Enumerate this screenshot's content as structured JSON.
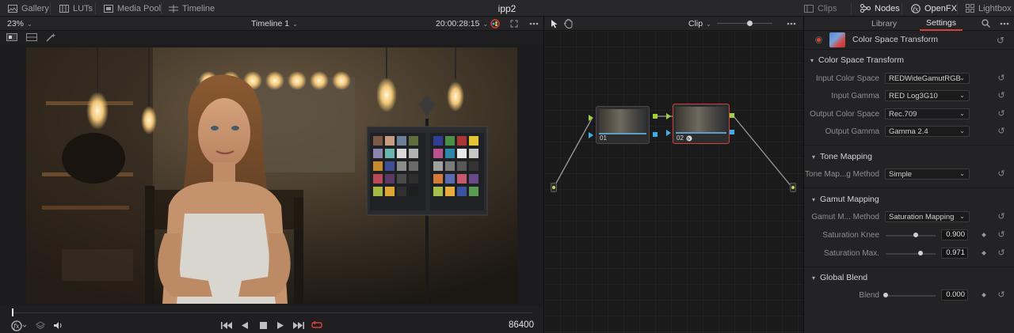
{
  "topbar": {
    "gallery": "Gallery",
    "luts": "LUTs",
    "media_pool": "Media Pool",
    "timeline": "Timeline",
    "project_title": "ipp2",
    "clips": "Clips",
    "nodes": "Nodes",
    "openfx": "OpenFX",
    "lightbox": "Lightbox"
  },
  "viewer": {
    "zoom": "23%",
    "timeline_name": "Timeline 1",
    "timecode": "20:00:28:15",
    "frame_counter": "86400"
  },
  "node_editor": {
    "mode": "Clip",
    "nodes": [
      {
        "label": "01"
      },
      {
        "label": "02"
      }
    ]
  },
  "inspector": {
    "tabs": [
      "Library",
      "Settings"
    ],
    "active_tab": "Settings",
    "fx_name": "Color Space Transform",
    "sections": {
      "cst": {
        "title": "Color Space Transform",
        "input_color_space_label": "Input Color Space",
        "input_color_space": "REDWideGamutRGB",
        "input_gamma_label": "Input Gamma",
        "input_gamma": "RED Log3G10",
        "output_color_space_label": "Output Color Space",
        "output_color_space": "Rec.709",
        "output_gamma_label": "Output Gamma",
        "output_gamma": "Gamma 2.4"
      },
      "tone": {
        "title": "Tone Mapping",
        "method_label": "Tone Map...g Method",
        "method": "Simple"
      },
      "gamut": {
        "title": "Gamut Mapping",
        "method_label": "Gamut M... Method",
        "method": "Saturation Mapping",
        "sat_knee_label": "Saturation Knee",
        "sat_knee": "0.900",
        "sat_knee_fraction": 0.6,
        "sat_max_label": "Saturation Max.",
        "sat_max": "0.971",
        "sat_max_fraction": 0.7
      },
      "blend": {
        "title": "Global Blend",
        "blend_label": "Blend",
        "blend": "0.000",
        "blend_fraction": 0.0
      }
    }
  },
  "colors": {
    "accent_red": "#d6403b",
    "port_green": "#9fd13a",
    "port_blue": "#3bb0e8"
  }
}
